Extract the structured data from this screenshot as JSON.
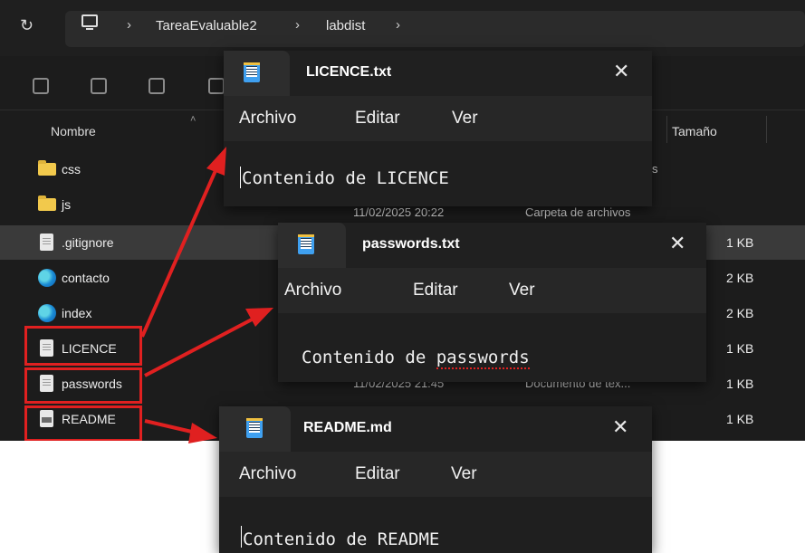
{
  "explorer": {
    "breadcrumbs": [
      "TareaEvaluable2",
      "labdist"
    ],
    "columns": {
      "name": "Nombre",
      "size": "Tamaño"
    },
    "files": [
      {
        "name": "css",
        "icon": "folder-icon",
        "date": "",
        "type": "s",
        "size": ""
      },
      {
        "name": "js",
        "icon": "folder-icon",
        "date": "11/02/2025 20:22",
        "type": "Carpeta de archivos",
        "size": ""
      },
      {
        "name": ".gitignore",
        "icon": "text-file-icon",
        "date": "",
        "type": "",
        "size": "1 KB"
      },
      {
        "name": "contacto",
        "icon": "edge-html-icon",
        "date": "",
        "type": "",
        "size": "2 KB"
      },
      {
        "name": "index",
        "icon": "edge-html-icon",
        "date": "",
        "type": "",
        "size": "2 KB"
      },
      {
        "name": "LICENCE",
        "icon": "text-file-icon",
        "date": "",
        "type": "",
        "size": "1 KB"
      },
      {
        "name": "passwords",
        "icon": "text-file-icon",
        "date": "11/02/2025 21:45",
        "type": "Documento de tex...",
        "size": "1 KB"
      },
      {
        "name": "README",
        "icon": "markdown-file-icon",
        "date": "",
        "type": "",
        "size": "1 KB"
      }
    ]
  },
  "notepads": {
    "licence": {
      "title": "LICENCE.txt",
      "close": "✕",
      "menu": [
        "Archivo",
        "Editar",
        "Ver"
      ],
      "content": "Contenido de LICENCE"
    },
    "passwords": {
      "title": "passwords.txt",
      "close": "✕",
      "menu": [
        "Archivo",
        "Editar",
        "Ver"
      ],
      "content_prefix": "Contenido de ",
      "content_word": "passwords"
    },
    "readme": {
      "title": "README.md",
      "close": "✕",
      "menu": [
        "Archivo",
        "Editar",
        "Ver"
      ],
      "content": "Contenido de README"
    }
  },
  "colors": {
    "annotation_red": "#e02020",
    "dark_bg": "#1c1c1c",
    "notepad_bg": "#272727"
  }
}
